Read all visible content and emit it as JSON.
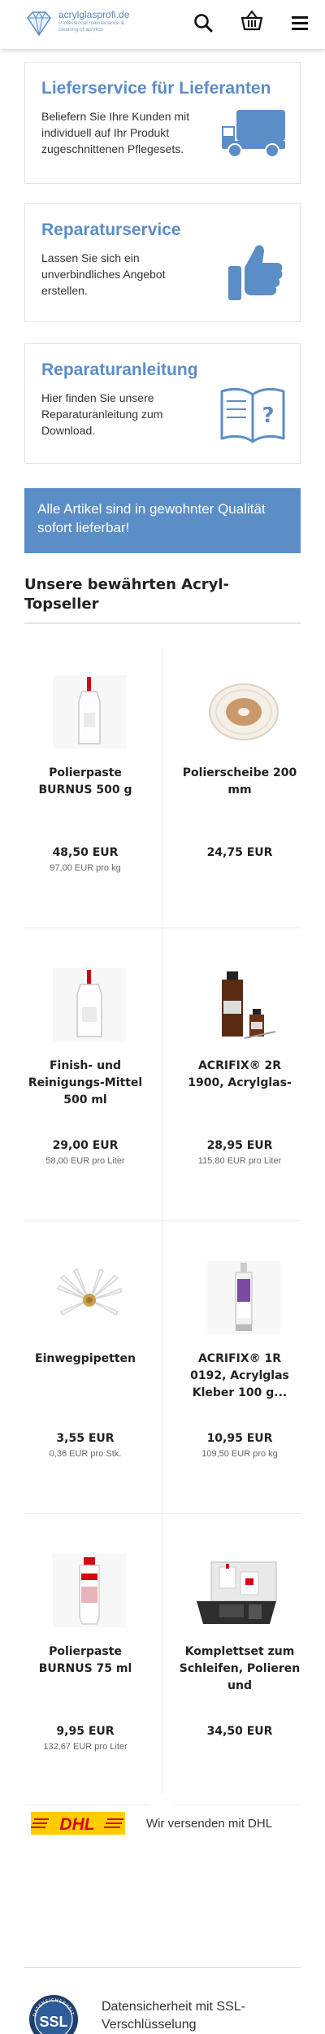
{
  "header": {
    "logo_name": "acrylglasprofi.de",
    "logo_tagline": "Professional maintenance & cleaning of acrylics",
    "icons": [
      "search-icon",
      "basket-icon",
      "menu-icon"
    ]
  },
  "promos": [
    {
      "title": "Lieferservice für Lieferanten",
      "text": "Beliefern Sie Ihre Kunden mit individuell auf Ihr Produkt zugeschnittenen Pflegesets.",
      "icon": "truck-icon"
    },
    {
      "title": "Reparaturservice",
      "text": "Lassen Sie sich ein unverbindliches Angebot erstellen.",
      "icon": "thumbs-up-icon"
    },
    {
      "title": "Reparaturanleitung",
      "text": "Hier finden Sie unsere Reparaturanleitung zum Download.",
      "icon": "manual-book-icon"
    }
  ],
  "banner": "Alle Artikel sind in gewohnter Qualität sofort lieferbar!",
  "topseller_title": "Unsere bewährten Acryl-Topseller",
  "products": [
    {
      "name": "Polierpaste BURNUS 500 g",
      "price": "48,50 EUR",
      "unit": "97,00 EUR pro kg",
      "icon": "paste-bottle-icon"
    },
    {
      "name": "Polierscheibe 200 mm",
      "price": "24,75 EUR",
      "unit": "",
      "icon": "polishing-disc-icon"
    },
    {
      "name": "Finish- und Reinigungs-Mittel 500 ml",
      "price": "29,00 EUR",
      "unit": "58,00 EUR pro Liter",
      "icon": "cleaner-bottle-icon"
    },
    {
      "name": "ACRIFIX® 2R 1900, Acrylglas-",
      "price": "28,95 EUR",
      "unit": "115,80 EUR pro Liter",
      "icon": "amber-bottles-icon"
    },
    {
      "name": "Einwegpipetten",
      "price": "3,55 EUR",
      "unit": "0,36 EUR pro Stk.",
      "icon": "pipettes-icon"
    },
    {
      "name": "ACRIFIX® 1R 0192, Acrylglas Kleber 100 g...",
      "price": "10,95 EUR",
      "unit": "109,50 EUR pro kg",
      "icon": "glue-tube-icon"
    },
    {
      "name": "Polierpaste BURNUS 75 ml",
      "price": "9,95 EUR",
      "unit": "132,67 EUR pro Liter",
      "icon": "paste-tube-icon"
    },
    {
      "name": "Komplettset zum Schleifen, Polieren und",
      "price": "34,50 EUR",
      "unit": "",
      "icon": "kit-box-icon"
    }
  ],
  "shipping": {
    "logo_text": "DHL",
    "text": "Wir versenden mit DHL"
  },
  "security": {
    "badge_text": "SSL",
    "badge_ring": "DATENSICHERHEIT",
    "text": "Datensicherheit mit SSL-Verschlüsselung"
  },
  "colors": {
    "accent": "#5b8dc7",
    "dhl_yellow": "#ffcc00",
    "dhl_red": "#d40511"
  }
}
